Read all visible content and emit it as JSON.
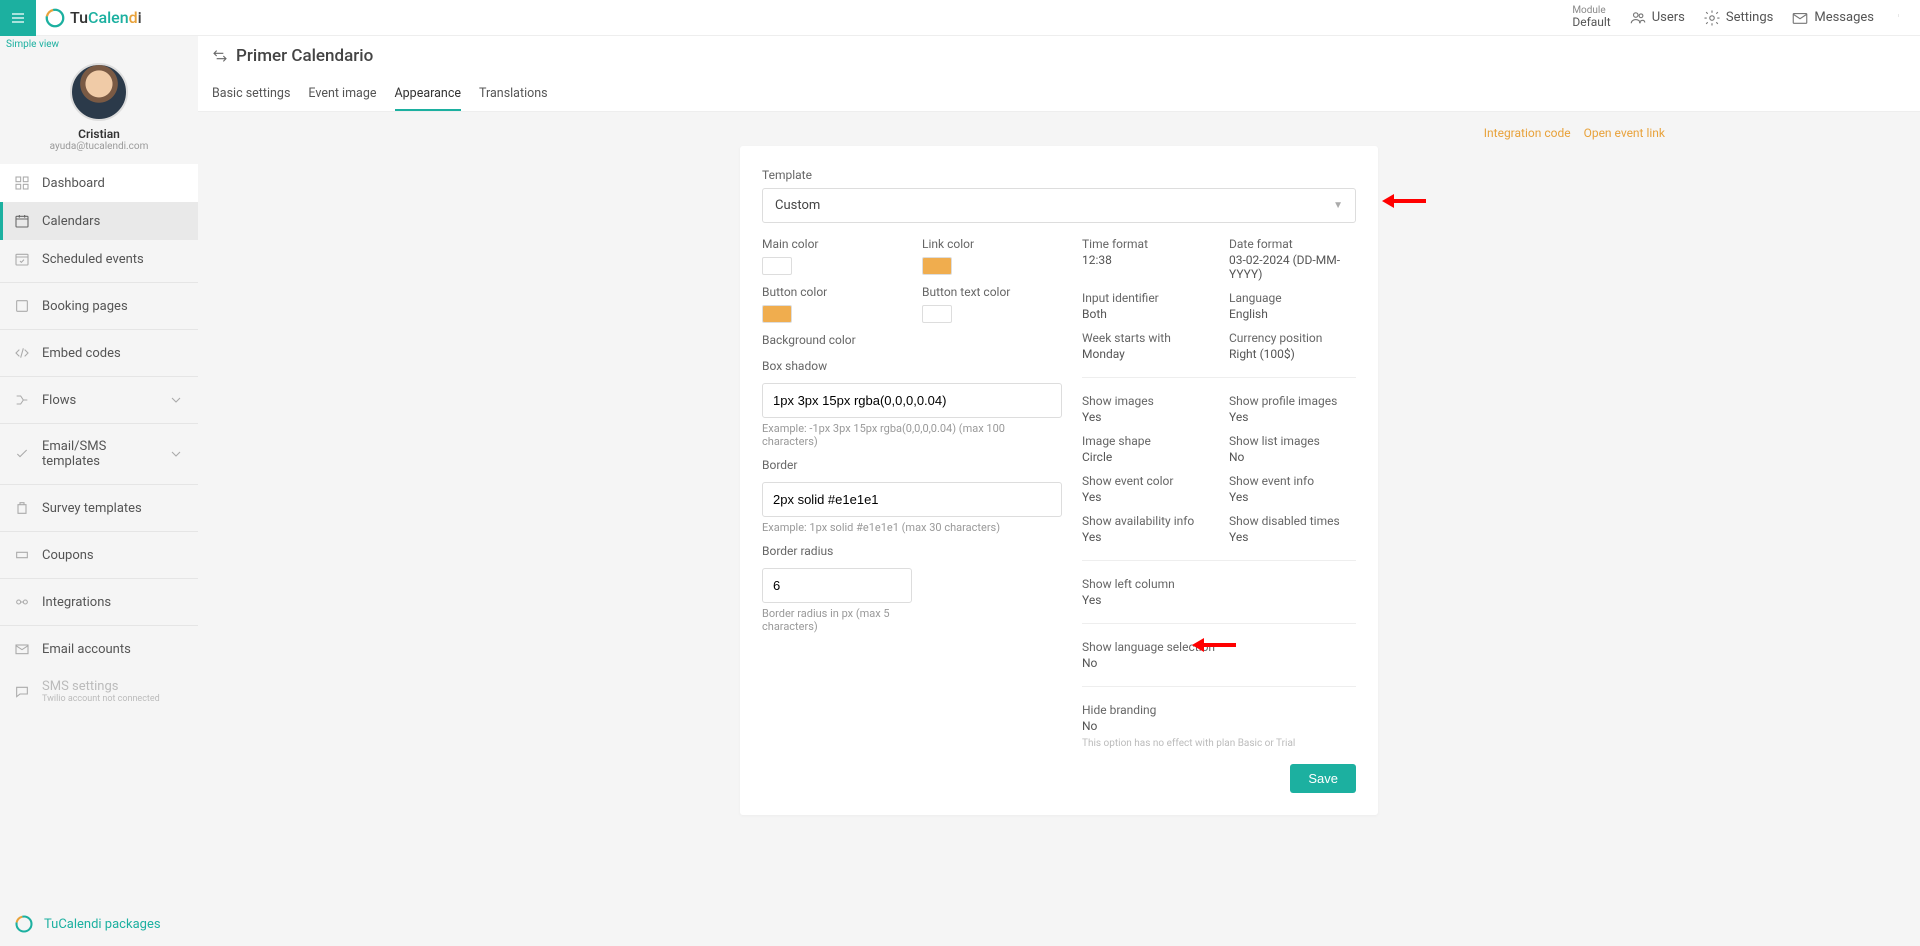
{
  "brand": {
    "tu": "Tu",
    "calen": "Calen",
    "d": "d",
    "i": "i"
  },
  "topbar": {
    "module_label": "Module",
    "module_value": "Default",
    "users": "Users",
    "settings": "Settings",
    "messages": "Messages"
  },
  "sidebar": {
    "simple_view": "Simple view",
    "profile_name": "Cristian",
    "profile_email": "ayuda@tucalendi.com",
    "items": {
      "dashboard": "Dashboard",
      "calendars": "Calendars",
      "scheduled_events": "Scheduled events",
      "booking_pages": "Booking pages",
      "embed_codes": "Embed codes",
      "flows": "Flows",
      "email_sms": "Email/SMS templates",
      "survey": "Survey templates",
      "coupons": "Coupons",
      "integrations": "Integrations",
      "email_accounts": "Email accounts",
      "sms_settings": "SMS settings",
      "sms_sub": "Twilio account not connected"
    },
    "footer": "TuCalendi packages"
  },
  "page": {
    "title": "Primer Calendario",
    "tabs": {
      "basic": "Basic settings",
      "image": "Event image",
      "appearance": "Appearance",
      "translations": "Translations"
    },
    "links": {
      "integration": "Integration code",
      "open_event": "Open event link"
    }
  },
  "form": {
    "template_label": "Template",
    "template_value": "Custom",
    "main_color_label": "Main color",
    "main_color": "#1cb0a0",
    "link_color_label": "Link color",
    "link_color": "#f0ad4e",
    "button_color_label": "Button color",
    "button_color": "#f0ad4e",
    "button_text_color_label": "Button text color",
    "button_text_color": "#ffffff",
    "background_color_label": "Background color",
    "background_color": "#28284a",
    "box_shadow_label": "Box shadow",
    "box_shadow_value": "1px 3px 15px rgba(0,0,0,0.04)",
    "box_shadow_hint": "Example: -1px 3px 15px rgba(0,0,0,0.04) (max 100 characters)",
    "border_label": "Border",
    "border_value": "2px solid #e1e1e1",
    "border_hint": "Example: 1px solid #e1e1e1 (max 30 characters)",
    "border_radius_label": "Border radius",
    "border_radius_value": "6",
    "border_radius_hint": "Border radius in px (max 5 characters)",
    "save": "Save"
  },
  "settings": {
    "time_format_l": "Time format",
    "time_format_v": "12:38",
    "date_format_l": "Date format",
    "date_format_v": "03-02-2024 (DD-MM-YYYY)",
    "input_id_l": "Input identifier",
    "input_id_v": "Both",
    "language_l": "Language",
    "language_v": "English",
    "week_start_l": "Week starts with",
    "week_start_v": "Monday",
    "currency_l": "Currency position",
    "currency_v": "Right (100$)",
    "show_images_l": "Show images",
    "show_images_v": "Yes",
    "show_profile_l": "Show profile images",
    "show_profile_v": "Yes",
    "image_shape_l": "Image shape",
    "image_shape_v": "Circle",
    "show_list_l": "Show list images",
    "show_list_v": "No",
    "show_color_l": "Show event color",
    "show_color_v": "Yes",
    "show_info_l": "Show event info",
    "show_info_v": "Yes",
    "show_avail_l": "Show availability info",
    "show_avail_v": "Yes",
    "show_disabled_l": "Show disabled times",
    "show_disabled_v": "Yes",
    "show_left_l": "Show left column",
    "show_left_v": "Yes",
    "show_lang_l": "Show language selection",
    "show_lang_v": "No",
    "hide_brand_l": "Hide branding",
    "hide_brand_v": "No",
    "hide_brand_note": "This option has no effect with plan Basic or Trial"
  }
}
